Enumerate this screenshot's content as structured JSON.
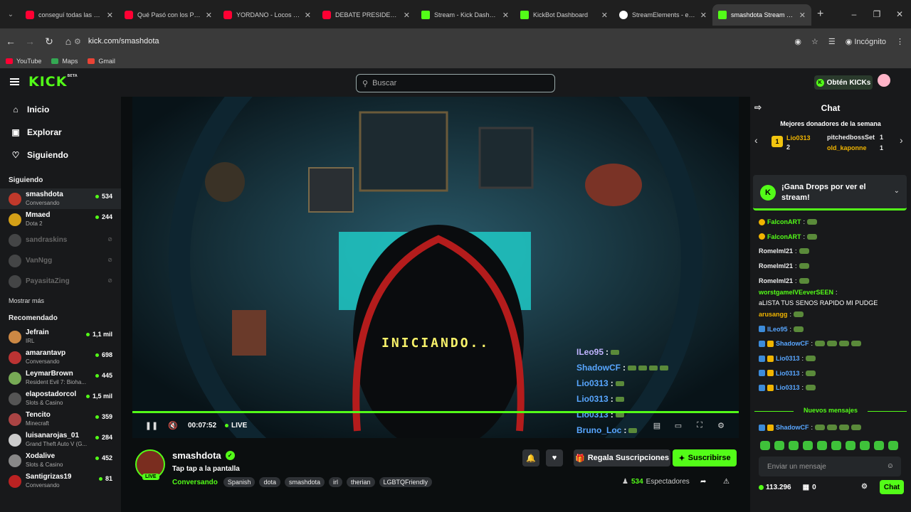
{
  "browser": {
    "tabs": [
      {
        "title": "conseguí todas las máscaras",
        "icon": "youtube"
      },
      {
        "title": "Qué Pasó con los PROTAGONISTAS",
        "icon": "youtube"
      },
      {
        "title": "YORDANO - Locos de amor",
        "icon": "youtube"
      },
      {
        "title": "DEBATE PRESIDENCIAL",
        "icon": "youtube"
      },
      {
        "title": "Stream - Kick Dashboard",
        "icon": "kick"
      },
      {
        "title": "KickBot Dashboard",
        "icon": "kick"
      },
      {
        "title": "StreamElements - emetes",
        "icon": "streamelements"
      },
      {
        "title": "smashdota Stream - Watch",
        "icon": "kick"
      }
    ],
    "url": "kick.com/smashdota",
    "incognito_label": "Incógnito",
    "bookmarks": [
      "YouTube",
      "Maps",
      "Gmail"
    ]
  },
  "header": {
    "logo": "KICK",
    "logo_badge": "BETA",
    "search_placeholder": "Buscar",
    "get_kicks_label": "Obtén KICKs"
  },
  "sidebar": {
    "nav": [
      {
        "label": "Inicio",
        "icon": "home-icon"
      },
      {
        "label": "Explorar",
        "icon": "compass-icon"
      },
      {
        "label": "Siguiendo",
        "icon": "heart-icon"
      }
    ],
    "following_title": "Siguiendo",
    "following": [
      {
        "name": "smashdota",
        "sub": "Conversando",
        "viewers": "534",
        "live": true
      },
      {
        "name": "Mmaed",
        "sub": "Dota 2",
        "viewers": "244",
        "live": true
      },
      {
        "name": "sandraskins",
        "sub": "",
        "viewers": "",
        "live": false
      },
      {
        "name": "VanNgg",
        "sub": "",
        "viewers": "",
        "live": false
      },
      {
        "name": "PayasitaZing",
        "sub": "",
        "viewers": "",
        "live": false
      }
    ],
    "show_more": "Mostrar más",
    "recommended_title": "Recomendado",
    "recommended": [
      {
        "name": "Jefrain",
        "sub": "IRL",
        "viewers": "1,1 mil"
      },
      {
        "name": "amarantavp",
        "sub": "Conversando",
        "viewers": "698"
      },
      {
        "name": "LeymarBrown",
        "sub": "Resident Evil 7: Bioha...",
        "viewers": "445"
      },
      {
        "name": "elapostadorcol",
        "sub": "Slots & Casino",
        "viewers": "1,5 mil"
      },
      {
        "name": "Tencito",
        "sub": "Minecraft",
        "viewers": "359"
      },
      {
        "name": "luisanarojas_01",
        "sub": "Grand Theft Auto V (G...",
        "viewers": "284"
      },
      {
        "name": "Xodalive",
        "sub": "Slots & Casino",
        "viewers": "452"
      },
      {
        "name": "Santigrizas19",
        "sub": "Conversando",
        "viewers": "81"
      }
    ]
  },
  "player": {
    "overlay_text": "INICIANDO..",
    "time": "00:07:52",
    "live_label": "LIVE",
    "overlay_chat": [
      {
        "user": "ILeo95",
        "sep": ":"
      },
      {
        "user": "ShadowCF",
        "sep": ":"
      },
      {
        "user": "Lio0313",
        "sep": ":"
      },
      {
        "user": "Lio0313",
        "sep": ":"
      },
      {
        "user": "Lio0313",
        "sep": ":"
      },
      {
        "user": "Bruno_Loc",
        "sep": ":"
      }
    ]
  },
  "stream_info": {
    "streamer": "smashdota",
    "live_badge": "LIVE",
    "title": "Tap tap a la pantalla",
    "category": "Conversando",
    "tags": [
      "Spanish",
      "dota",
      "smashdota",
      "irl",
      "therian",
      "LGBTQFriendly"
    ],
    "gift_label": "Regala Suscripciones",
    "subscribe_label": "Suscribirse",
    "viewers": "534",
    "viewers_label": "Espectadores"
  },
  "chat": {
    "title": "Chat",
    "donors_title": "Mejores donadores de la semana",
    "top_donor": {
      "name": "Lio0313",
      "amount": "2",
      "rank": "1"
    },
    "donor_2": {
      "name": "pitchedbossSet",
      "amount": "1"
    },
    "donor_3": {
      "name": "old_kaponne",
      "amount": "1"
    },
    "drops_text": "¡Gana Drops por ver el stream!",
    "messages": [
      {
        "user": "FalconART",
        "color": "#53fc18",
        "text": "",
        "emotes": 1,
        "badge": "coin"
      },
      {
        "user": "FalconART",
        "color": "#53fc18",
        "text": "",
        "emotes": 1,
        "badge": "coin"
      },
      {
        "user": "Romelml21",
        "color": "#eeeeee",
        "text": "",
        "emotes": 1,
        "badge": ""
      },
      {
        "user": "Romelml21",
        "color": "#eeeeee",
        "text": "",
        "emotes": 1,
        "badge": ""
      },
      {
        "user": "Romelml21",
        "color": "#eeeeee",
        "text": "",
        "emotes": 1,
        "badge": ""
      },
      {
        "user": "worstgameIVEeverSEEN",
        "color": "#53fc18",
        "text": "aLISTA TUS SENOS RAPIDO MI PUDGE",
        "emotes": 0,
        "badge": ""
      },
      {
        "user": "arusangg",
        "color": "#f0b400",
        "text": "",
        "emotes": 1,
        "badge": ""
      },
      {
        "user": "ILeo95",
        "color": "#58a6ff",
        "text": "",
        "emotes": 1,
        "badge": "vip"
      },
      {
        "user": "ShadowCF",
        "color": "#58a6ff",
        "text": "",
        "emotes": 4,
        "badge": "vip-sub"
      },
      {
        "user": "Lio0313",
        "color": "#58a6ff",
        "text": "",
        "emotes": 1,
        "badge": "vip-sub"
      },
      {
        "user": "Lio0313",
        "color": "#58a6ff",
        "text": "",
        "emotes": 1,
        "badge": "vip-sub"
      },
      {
        "user": "Lio0313",
        "color": "#58a6ff",
        "text": "",
        "emotes": 1,
        "badge": "vip-sub"
      }
    ],
    "new_messages_label": "Nuevos mensajes",
    "after_new": {
      "user": "ShadowCF",
      "color": "#58a6ff",
      "emotes": 4
    },
    "input_placeholder": "Enviar un mensaje",
    "points": "113.296",
    "drops_count": "0",
    "send_label": "Chat"
  },
  "colors": {
    "accent": "#53fc18",
    "bg": "#0b0e0f",
    "panel": "#18191b"
  }
}
